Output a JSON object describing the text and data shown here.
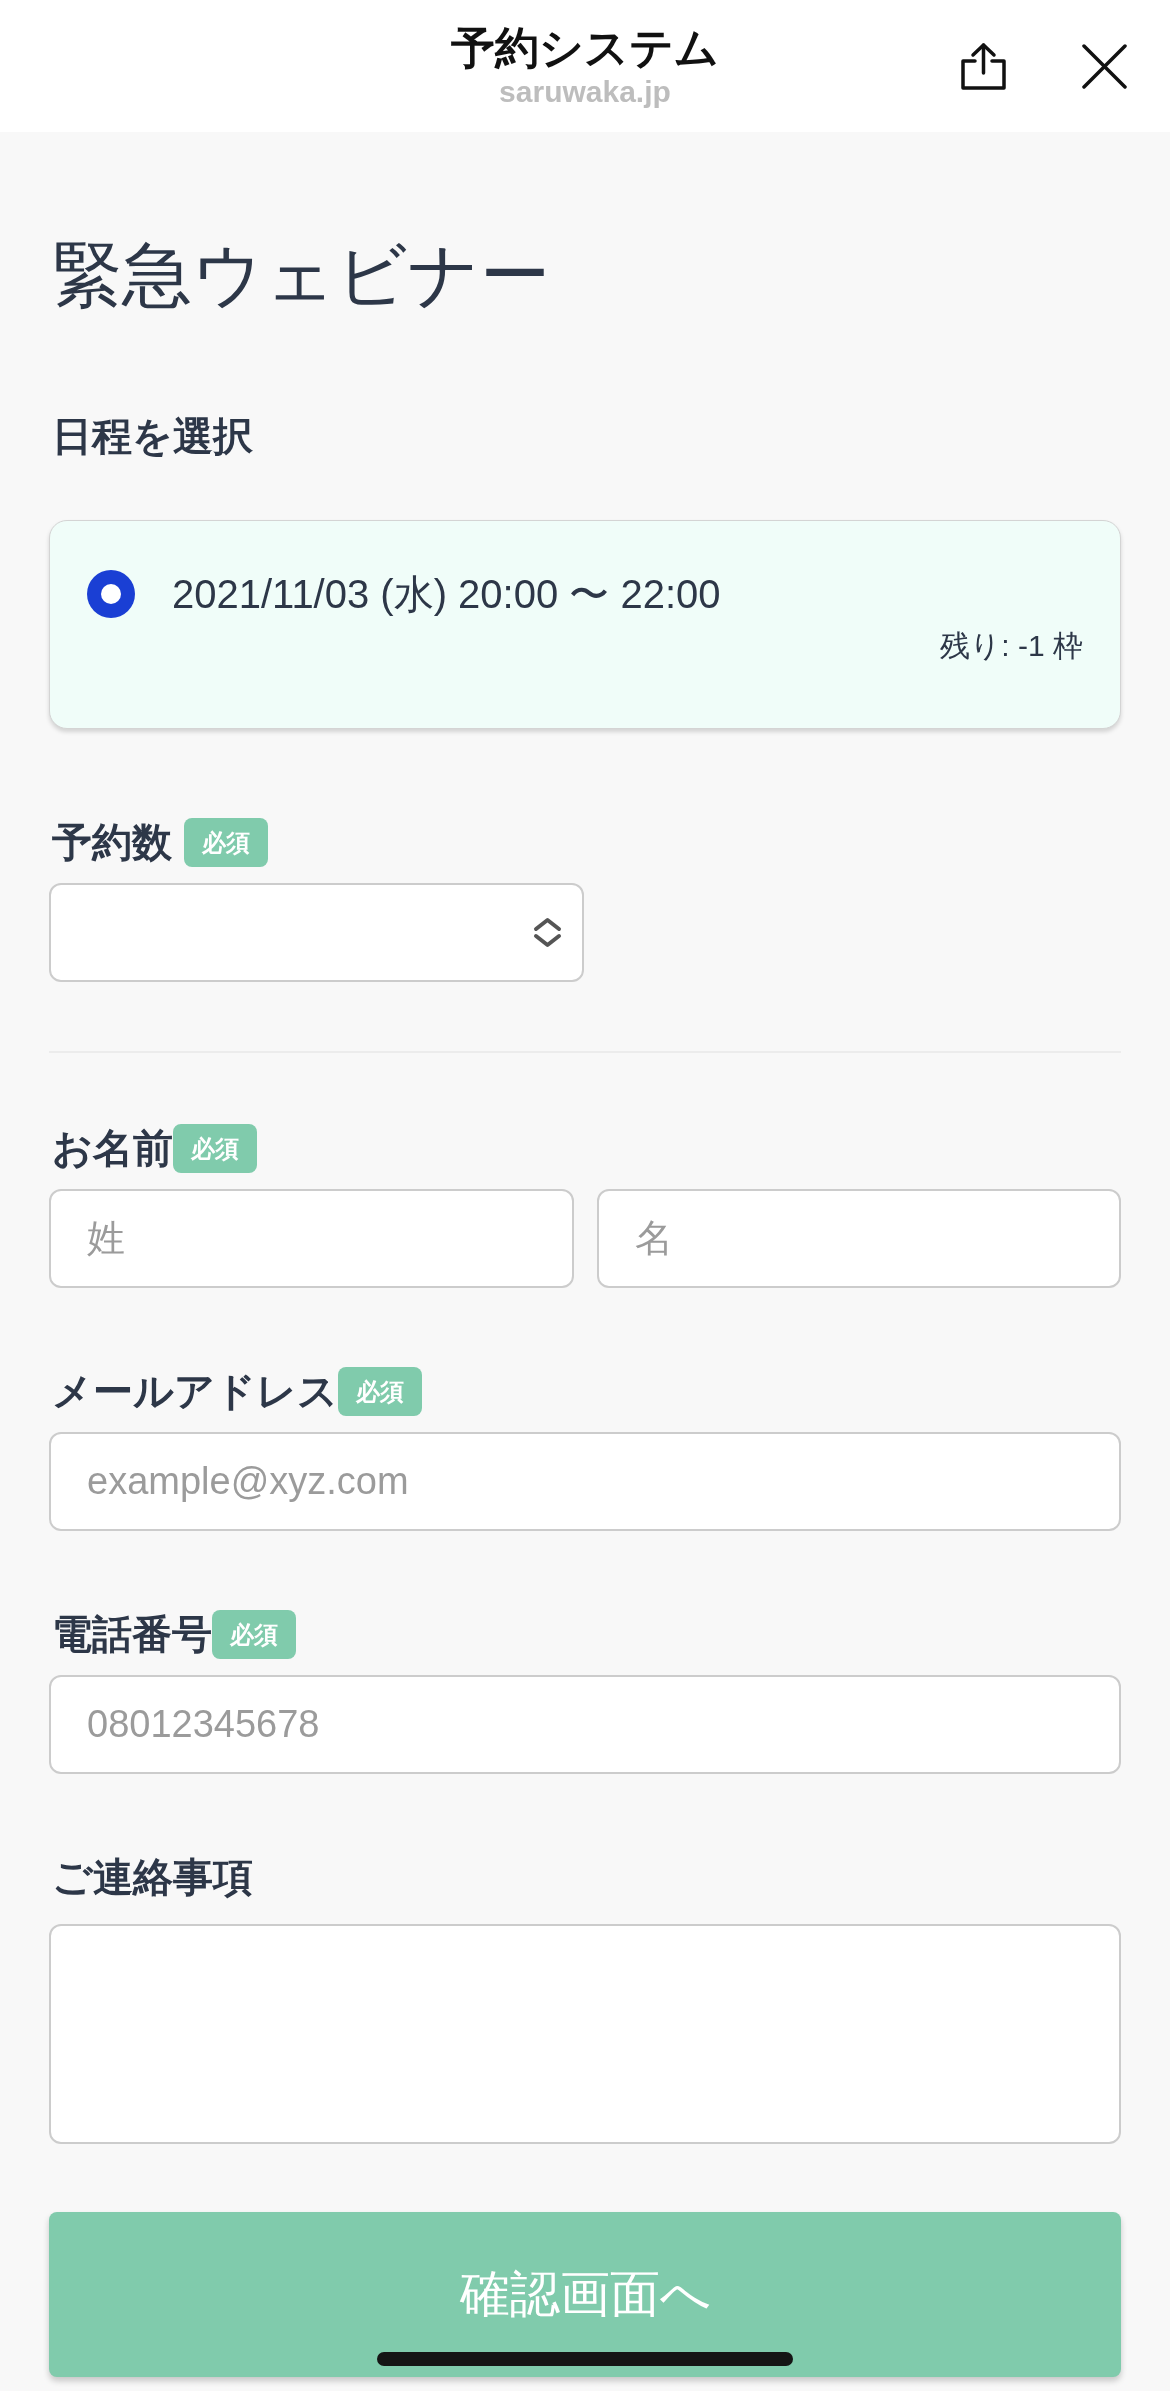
{
  "header": {
    "title": "予約システム",
    "subtitle": "saruwaka.jp"
  },
  "page_title": "緊急ウェビナー",
  "schedule": {
    "label": "日程を選択",
    "options": [
      {
        "datetime": "2021/11/03 (水) 20:00 〜 22:00",
        "remaining": "残り: -1 枠",
        "selected": true
      }
    ]
  },
  "form_sections": [
    {
      "fields": [
        {
          "kind": "select",
          "label": "予約数",
          "badge": "必須"
        }
      ]
    },
    {
      "fields": [
        {
          "kind": "name",
          "label": "お名前",
          "badge": "必須",
          "placeholders": [
            "姓",
            "名"
          ]
        },
        {
          "kind": "text",
          "label": "メールアドレス",
          "badge": "必須",
          "placeholder": "example@xyz.com"
        },
        {
          "kind": "text",
          "label": "電話番号",
          "badge": "必須",
          "placeholder": "08012345678"
        },
        {
          "kind": "textarea",
          "label": "ご連絡事項"
        }
      ]
    }
  ],
  "submit_button": {
    "label": "確認画面へ"
  }
}
